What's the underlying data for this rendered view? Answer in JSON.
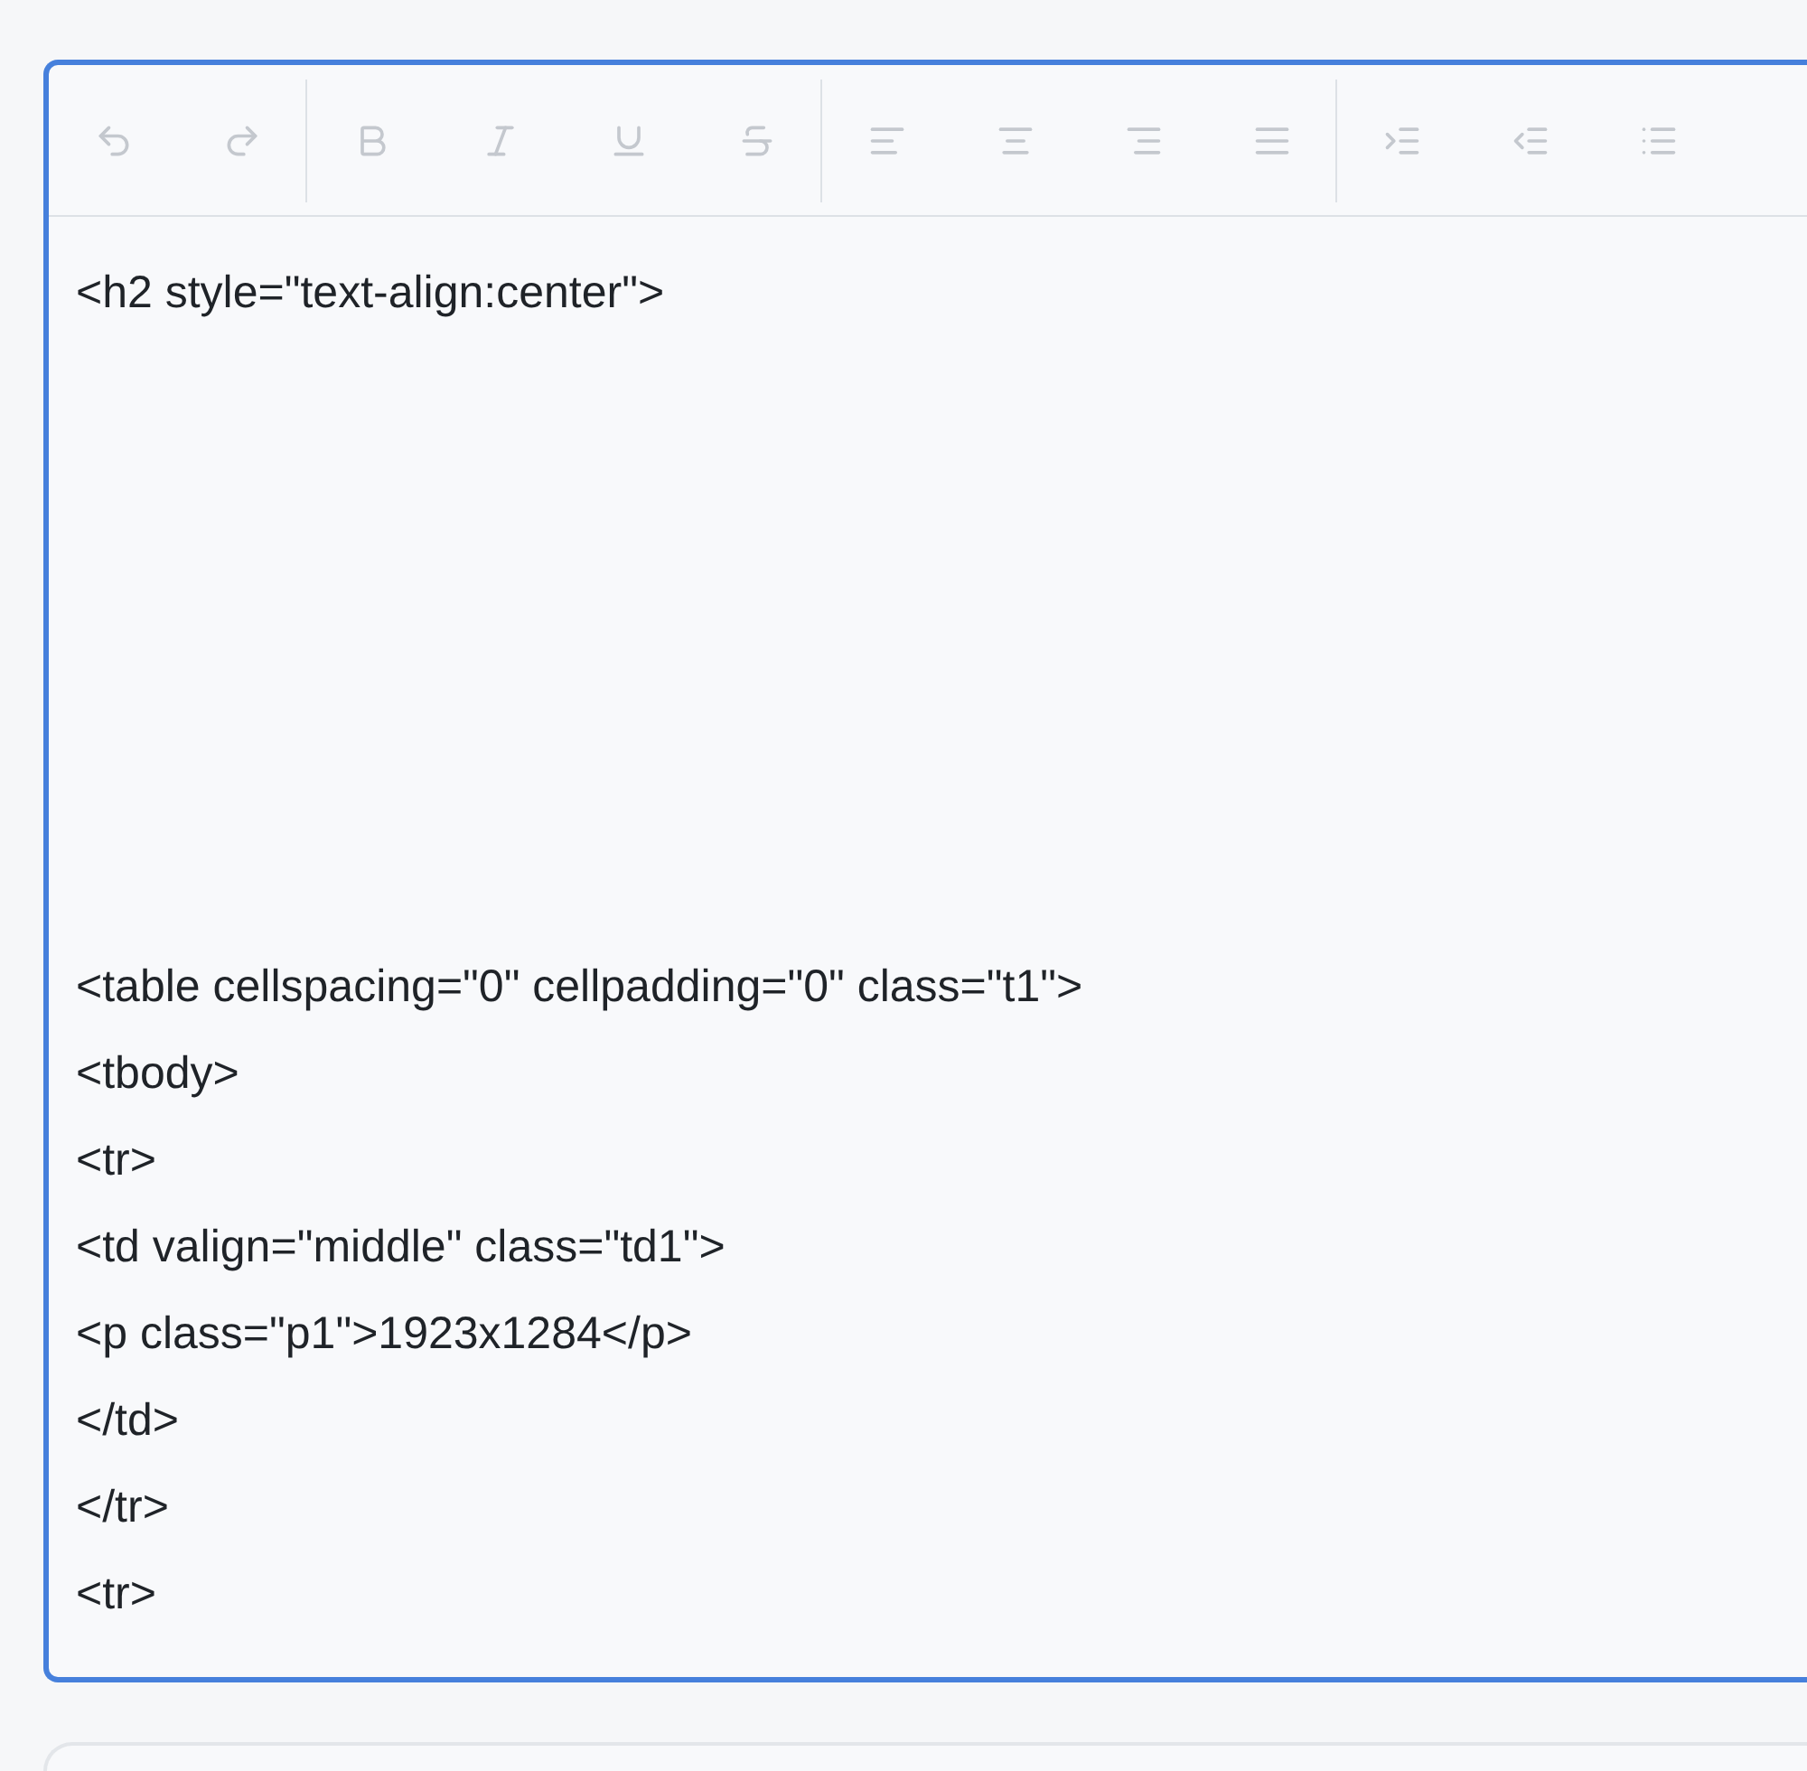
{
  "editor": {
    "toolbar": [
      [
        {
          "kind": "undo",
          "disabled": true
        },
        {
          "kind": "redo",
          "disabled": true
        }
      ],
      [
        {
          "kind": "bold",
          "disabled": true
        },
        {
          "kind": "italic",
          "disabled": true
        },
        {
          "kind": "underline",
          "disabled": true
        },
        {
          "kind": "strikethrough",
          "disabled": true
        }
      ],
      [
        {
          "kind": "align-left",
          "disabled": true
        },
        {
          "kind": "align-center",
          "disabled": true
        },
        {
          "kind": "align-right",
          "disabled": true
        },
        {
          "kind": "align-justify",
          "disabled": true
        }
      ],
      [
        {
          "kind": "indent",
          "disabled": true
        },
        {
          "kind": "outdent",
          "disabled": true
        },
        {
          "kind": "bullet-list",
          "disabled": true
        }
      ]
    ],
    "focused": true,
    "value": "<h2 style=\"text-align:center\">\n\n\n\n\n\n\n\n<table cellspacing=\"0\" cellpadding=\"0\" class=\"t1\">\n<tbody>\n<tr>\n<td valign=\"middle\" class=\"td1\">\n<p class=\"p1\">1923x1284</p>\n</td>\n</tr>\n<tr>"
  }
}
